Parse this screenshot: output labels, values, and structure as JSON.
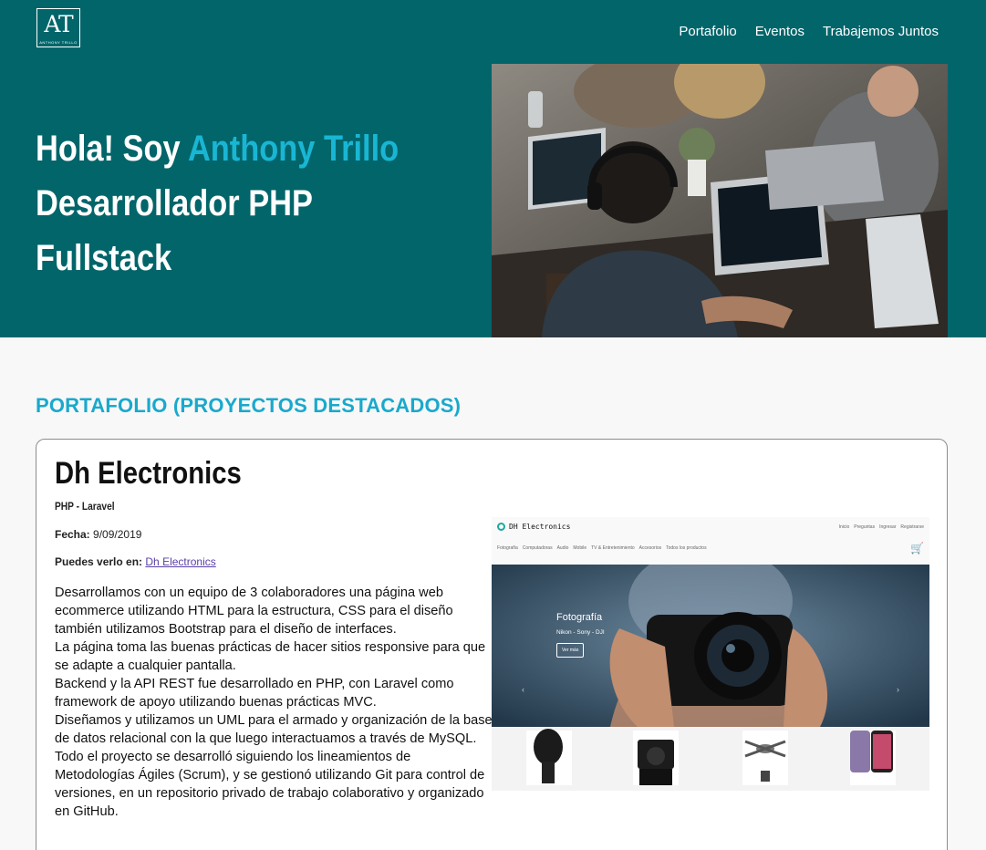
{
  "logo": {
    "mono": "AT",
    "sub": "ANTHONY TRILLO"
  },
  "nav": {
    "items": [
      "Portafolio",
      "Eventos",
      "Trabajemos Juntos"
    ]
  },
  "hero": {
    "greeting": "Hola! Soy",
    "name": "Anthony Trillo",
    "line2": "Desarrollador PHP",
    "line3": "Fullstack",
    "photo_icon": "team-working-laptops-photo"
  },
  "colors": {
    "header_bg": "#01656a",
    "accent": "#19b6d4",
    "section_title": "#19a9cc"
  },
  "portfolio": {
    "title": "PORTAFOLIO (PROYECTOS DESTACADOS)",
    "projects": [
      {
        "name": "Dh Electronics",
        "tech": "PHP - Laravel",
        "date_label": "Fecha:",
        "date": "9/09/2019",
        "link_label": "Puedes verlo en:",
        "link_text": "Dh Electronics",
        "description": [
          "Desarrollamos con un equipo de 3 colaboradores una página web ecommerce utilizando HTML para la estructura, CSS para el diseño también utilizamos Bootstrap para el diseño de interfaces.",
          "La página toma las buenas prácticas de hacer sitios responsive para que se adapte a cualquier pantalla.",
          "Backend y la API REST fue desarrollado en PHP, con Laravel como framework de apoyo utilizando buenas prácticas MVC.",
          "Diseñamos y utilizamos un UML para el armado y organización de la base de datos relacional con la que luego interactuamos a través de MySQL.",
          "Todo el proyecto se desarrolló siguiendo los lineamientos de Metodologías Ágiles (Scrum), y se gestionó utilizando Git para control de versiones, en un repositorio privado de trabajo colaborativo y organizado en GitHub."
        ],
        "screenshot": {
          "brand": "DH Electronics",
          "top_links": [
            "Inicio",
            "Preguntas",
            "Ingresar",
            "Registrarse"
          ],
          "menu": [
            "Fotografía",
            "Computadoras",
            "Audio",
            "Mobile",
            "TV & Entretenimiento",
            "Accesorios",
            "Todos los productos"
          ],
          "slide_title": "Fotografía",
          "slide_sub": "Nikon - Sony - DJI",
          "slide_button": "Ver más",
          "products": [
            "microphone",
            "camera",
            "drone",
            "phone"
          ]
        }
      }
    ]
  }
}
